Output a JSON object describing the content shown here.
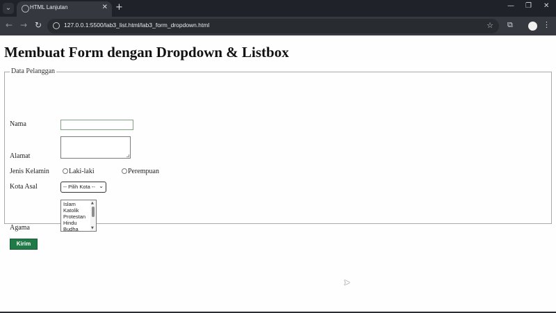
{
  "browser": {
    "tab_title": "HTML Lanjutan",
    "url": "127.0.0.1:5500/lab3_list.html/lab3_form_dropdown.html",
    "icons": {
      "tab_menu": "chevron-down-icon",
      "tab_close": "close-icon",
      "new_tab": "plus-icon",
      "back": "back-arrow-icon",
      "forward": "forward-arrow-icon",
      "reload": "reload-icon",
      "site_info": "site-info-icon",
      "bookmark": "star-icon",
      "extensions": "puzzle-icon",
      "profile": "profile-icon",
      "menu": "vertical-dots-icon",
      "minimize": "minimize-icon",
      "restore": "restore-icon",
      "close_window": "close-icon"
    },
    "glyphs": {
      "tab_menu": "⌄",
      "tab_close": "✕",
      "new_tab": "+",
      "back": "←",
      "forward": "→",
      "reload": "↻",
      "bookmark": "☆",
      "extensions": "⧉",
      "menu": "⋮",
      "minimize": "—",
      "restore": "❐",
      "close_window": "✕"
    }
  },
  "page": {
    "heading": "Membuat Form dengan Dropdown & Listbox",
    "form": {
      "legend": "Data Pelanggan",
      "fields": {
        "nama_label": "Nama",
        "nama_value": "",
        "alamat_label": "Alamat",
        "alamat_value": "",
        "jenis_kelamin_label": "Jenis Kelamin",
        "gender_options": [
          "Laki-laki",
          "Perempuan"
        ],
        "kota_label": "Kota Asal",
        "kota_selected": "-- Pilih Kota --",
        "agama_label": "Agama",
        "agama_options": [
          "Islam",
          "Katolik",
          "Protestan",
          "Hindu",
          "Budha"
        ]
      },
      "submit_label": "Kirim",
      "submit_color": "#1f7a48"
    }
  }
}
